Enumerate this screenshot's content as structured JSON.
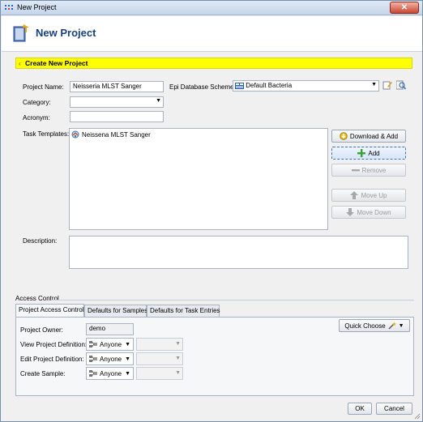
{
  "window": {
    "title": "New Project",
    "close_label": "✕"
  },
  "header": {
    "title": "New Project"
  },
  "banner": {
    "label": "Create New Project"
  },
  "form": {
    "project_name_label": "Project Name:",
    "project_name_value": "Neisseria MLST Sanger",
    "epi_scheme_label": "Epi Database Scheme:",
    "epi_scheme_value": "Default Bacteria",
    "category_label": "Category:",
    "category_value": "",
    "acronym_label": "Acronym:",
    "acronym_value": "",
    "task_templates_label": "Task Templates:",
    "task_templates": [
      {
        "label": "Neissena MLST Sanger"
      }
    ],
    "description_label": "Description:",
    "description_value": ""
  },
  "template_buttons": {
    "download_add": "Download & Add",
    "add": "Add",
    "remove": "Remove",
    "move_up": "Move Up",
    "move_down": "Move Down"
  },
  "access_control": {
    "section_label": "Access Control",
    "tabs": [
      {
        "label": "Project Access Control",
        "active": true
      },
      {
        "label": "Defaults for Samples",
        "active": false
      },
      {
        "label": "Defaults for Task Entries",
        "active": false
      }
    ],
    "quick_choose_label": "Quick Choose",
    "owner_label": "Project Owner:",
    "owner_value": "demo",
    "rows": [
      {
        "label": "View Project Definition:",
        "value": "Anyone"
      },
      {
        "label": "Edit Project Definition:",
        "value": "Anyone"
      },
      {
        "label": "Create Sample:",
        "value": "Anyone"
      }
    ]
  },
  "footer": {
    "ok_label": "OK",
    "cancel_label": "Cancel"
  },
  "colors": {
    "banner": "#ffff00",
    "heading": "#1b3f7c",
    "focus_border": "#3b74c6"
  }
}
